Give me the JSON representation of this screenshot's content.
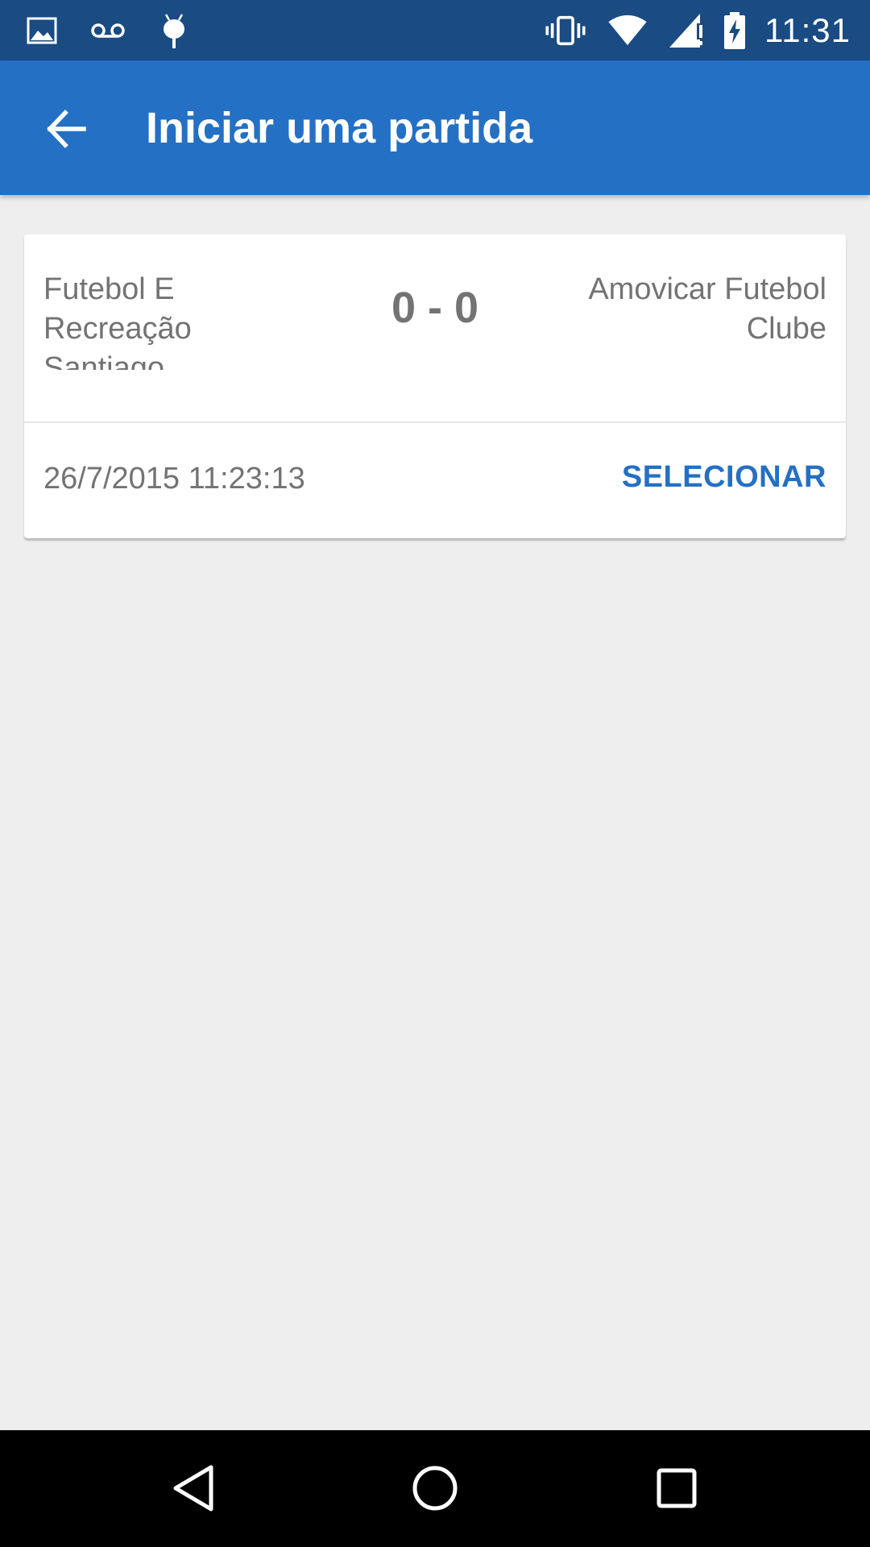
{
  "status_bar": {
    "time": "11:31",
    "left_icons": [
      "image-icon",
      "voicemail-icon",
      "android-icon"
    ],
    "right_icons": [
      "vibrate-icon",
      "wifi-icon",
      "signal-icon",
      "battery-charging-icon"
    ]
  },
  "app_bar": {
    "title": "Iniciar uma partida",
    "back_icon": "arrow-back-icon",
    "background_color": "#2470c4"
  },
  "match_card": {
    "home_team": "Futebol E Recreação Santiago",
    "score": "0 - 0",
    "away_team": "Amovicar Futebol Clube",
    "date_time": "26/7/2015 11:23:13",
    "select_label": "SELECIONAR",
    "accent_color": "#2470c4"
  },
  "nav_bar": {
    "buttons": [
      "back-triangle-icon",
      "home-circle-icon",
      "recents-square-icon"
    ]
  }
}
